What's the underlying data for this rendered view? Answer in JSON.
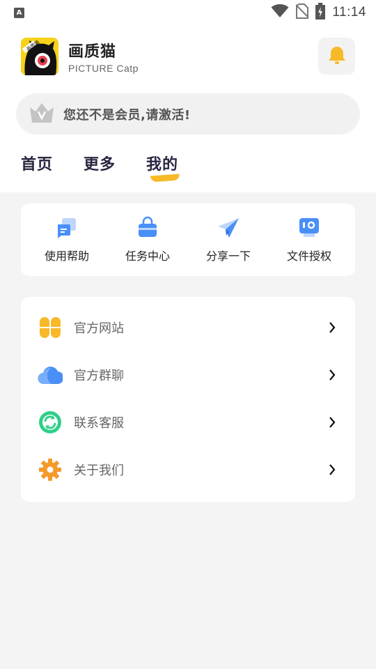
{
  "status_bar": {
    "left_icon": "a-icon",
    "left_icon_letter": "A",
    "time": "11:14",
    "icons": [
      "wifi-icon",
      "no-sim-icon",
      "battery-charging-icon"
    ]
  },
  "app": {
    "name": "画质猫",
    "subtitle": "PICTURE Catp",
    "logo_icon": "cat-logo-icon",
    "notification_icon": "bell-icon"
  },
  "vip": {
    "text": "您还不是会员,请激活!",
    "icon": "crown-icon"
  },
  "tabs": [
    {
      "label": "首页"
    },
    {
      "label": "更多"
    },
    {
      "label": "我的",
      "active": true
    }
  ],
  "quick_actions": [
    {
      "label": "使用帮助",
      "icon": "help-chat-icon"
    },
    {
      "label": "任务中心",
      "icon": "task-bag-icon"
    },
    {
      "label": "分享一下",
      "icon": "share-plane-icon"
    },
    {
      "label": "文件授权",
      "icon": "file-auth-icon"
    }
  ],
  "menu": [
    {
      "label": "官方网站",
      "icon": "grid-flower-icon"
    },
    {
      "label": "官方群聊",
      "icon": "cloud-icon"
    },
    {
      "label": "联系客服",
      "icon": "refresh-circle-icon"
    },
    {
      "label": "关于我们",
      "icon": "gear-icon"
    }
  ],
  "colors": {
    "accent_yellow": "#f7b928",
    "blue": "#4a8ff7",
    "green": "#2fcf8a",
    "orange": "#f59a2a",
    "background": "#f4f4f4"
  }
}
